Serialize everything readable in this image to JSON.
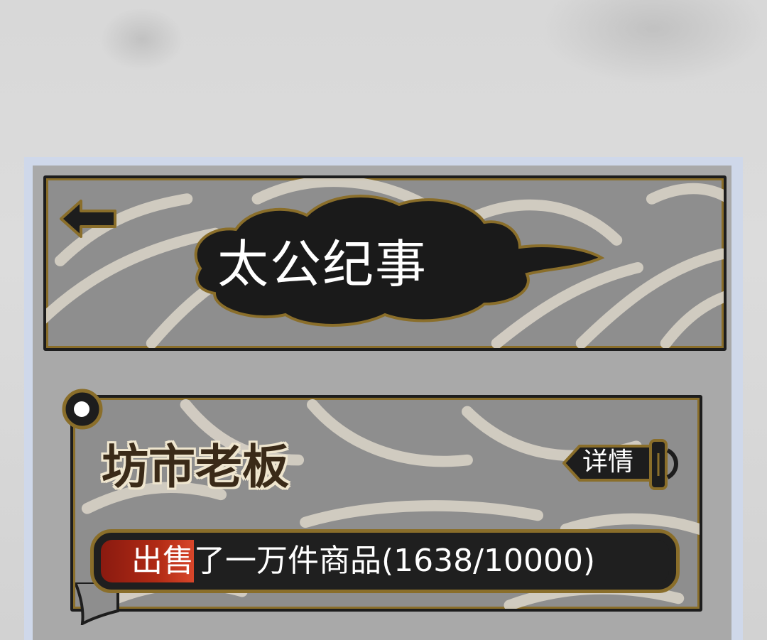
{
  "header": {
    "title": "太公纪事",
    "back_icon": "back-arrow-icon"
  },
  "achievement": {
    "title": "坊市老板",
    "detail_label": "详情",
    "progress_text": "出售了一万件商品(1638/10000)",
    "progress_current": 1638,
    "progress_total": 10000
  },
  "colors": {
    "panel_border": "#cfd8ea",
    "frame_gold": "#8a6e2a",
    "progress_fill": "#b02a14",
    "ink_black": "#1d1d1d"
  }
}
